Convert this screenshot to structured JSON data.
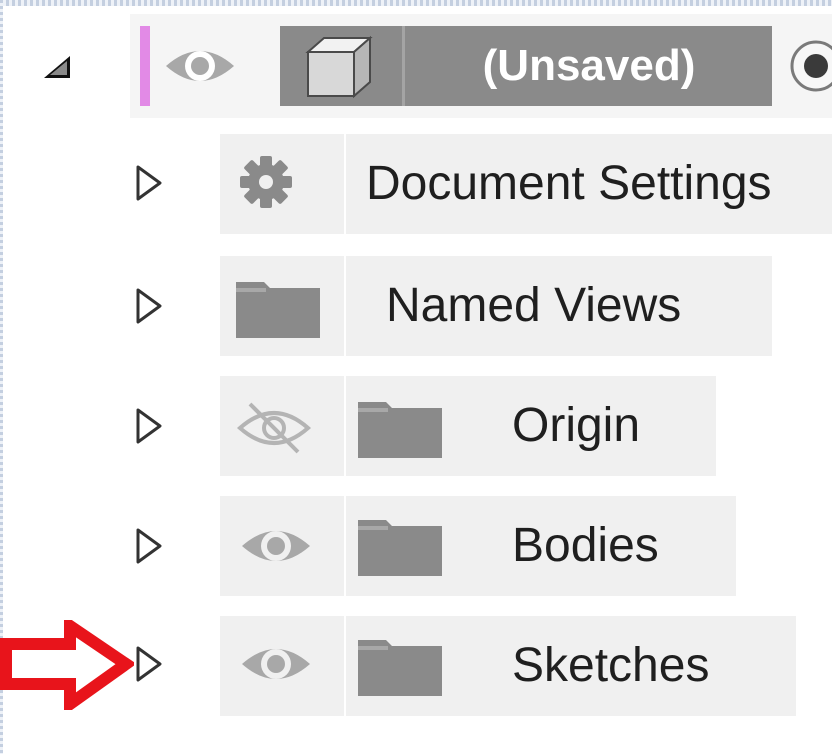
{
  "colors": {
    "accent_pink": "#e28ae6",
    "icon_gray": "#8a8a8a",
    "row_bg": "#f0f0f0",
    "annotation_red": "#e8141b"
  },
  "tree": {
    "root": {
      "name": "(Unsaved)",
      "expanded": true,
      "visible": true,
      "icons": [
        "expanded-triangle-icon",
        "eye-icon",
        "component-cube-icon",
        "active-radio-icon"
      ]
    },
    "items": [
      {
        "label": "Document Settings",
        "icon": "gear-icon",
        "has_visibility": false,
        "visible": null
      },
      {
        "label": "Named Views",
        "icon": "folder-icon",
        "has_visibility": false,
        "visible": null
      },
      {
        "label": "Origin",
        "icon": "folder-icon",
        "has_visibility": true,
        "visible": false
      },
      {
        "label": "Bodies",
        "icon": "folder-icon",
        "has_visibility": true,
        "visible": true
      },
      {
        "label": "Sketches",
        "icon": "folder-icon",
        "has_visibility": true,
        "visible": true
      }
    ]
  },
  "annotation": {
    "icon": "red-arrow-icon",
    "target": "Sketches expand toggle"
  }
}
